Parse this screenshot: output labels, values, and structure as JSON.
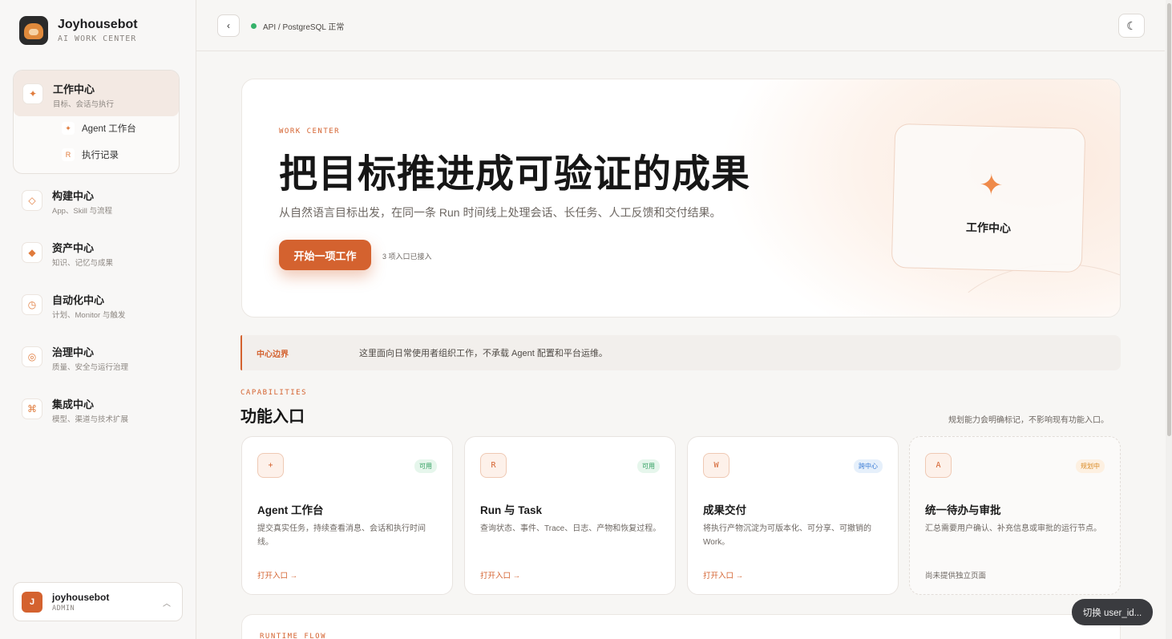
{
  "brand": {
    "name": "Joyhousebot",
    "subtitle": "AI WORK CENTER"
  },
  "sidebar": {
    "groups": [
      {
        "title": "工作中心",
        "subtitle": "目标、会话与执行",
        "icon": "sparkle-icon"
      },
      {
        "title": "构建中心",
        "subtitle": "App、Skill 与流程",
        "icon": "diamond-outline-icon"
      },
      {
        "title": "资产中心",
        "subtitle": "知识、记忆与成果",
        "icon": "diamond-filled-icon"
      },
      {
        "title": "自动化中心",
        "subtitle": "计划、Monitor 与触发",
        "icon": "clock-icon"
      },
      {
        "title": "治理中心",
        "subtitle": "质量、安全与运行治理",
        "icon": "target-icon"
      },
      {
        "title": "集成中心",
        "subtitle": "模型、渠道与技术扩展",
        "icon": "command-icon"
      }
    ],
    "subitems": [
      {
        "label": "Agent 工作台",
        "icon": "sparkle-icon",
        "glyph": "✦"
      },
      {
        "label": "执行记录",
        "icon": "r-letter-icon",
        "glyph": "R"
      }
    ]
  },
  "user": {
    "initial": "J",
    "name": "joyhousebot",
    "role": "ADMIN"
  },
  "topbar": {
    "status": "API / PostgreSQL 正常",
    "status_color": "#35b26a"
  },
  "hero": {
    "kicker": "WORK CENTER",
    "title": "把目标推进成可验证的成果",
    "description": "从自然语言目标出发，在同一条 Run 时间线上处理会话、长任务、人工反馈和交付结果。",
    "cta": "开始一项工作",
    "note": "3 项入口已接入",
    "card_label": "工作中心"
  },
  "boundary": {
    "label": "中心边界",
    "text": "这里面向日常使用者组织工作，不承载 Agent 配置和平台运维。"
  },
  "capabilities": {
    "kicker": "CAPABILITIES",
    "title": "功能入口",
    "note": "规划能力会明确标记，不影响现有功能入口。",
    "cards": [
      {
        "icon": "+",
        "badge": "可用",
        "title": "Agent 工作台",
        "description": "提交真实任务，持续查看消息、会话和执行时间线。",
        "link": "打开入口 →"
      },
      {
        "icon": "R",
        "badge": "可用",
        "title": "Run 与 Task",
        "description": "查询状态、事件、Trace、日志、产物和恢复过程。",
        "link": "打开入口 →"
      },
      {
        "icon": "W",
        "badge": "跨中心",
        "title": "成果交付",
        "description": "将执行产物沉淀为可版本化、可分享、可撤销的 Work。",
        "link": "打开入口 →"
      },
      {
        "icon": "A",
        "badge": "规划中",
        "title": "统一待办与审批",
        "description": "汇总需要用户确认、补充信息或审批的运行节点。",
        "link": "尚未提供独立页面"
      }
    ]
  },
  "runtime": {
    "kicker": "RUNTIME FLOW"
  },
  "toast": {
    "text": "切换 user_id..."
  },
  "colors": {
    "accent": "#d4622f",
    "available": "#2f9e5e",
    "cross_center": "#3a7bd5",
    "planned": "#d98a25"
  }
}
